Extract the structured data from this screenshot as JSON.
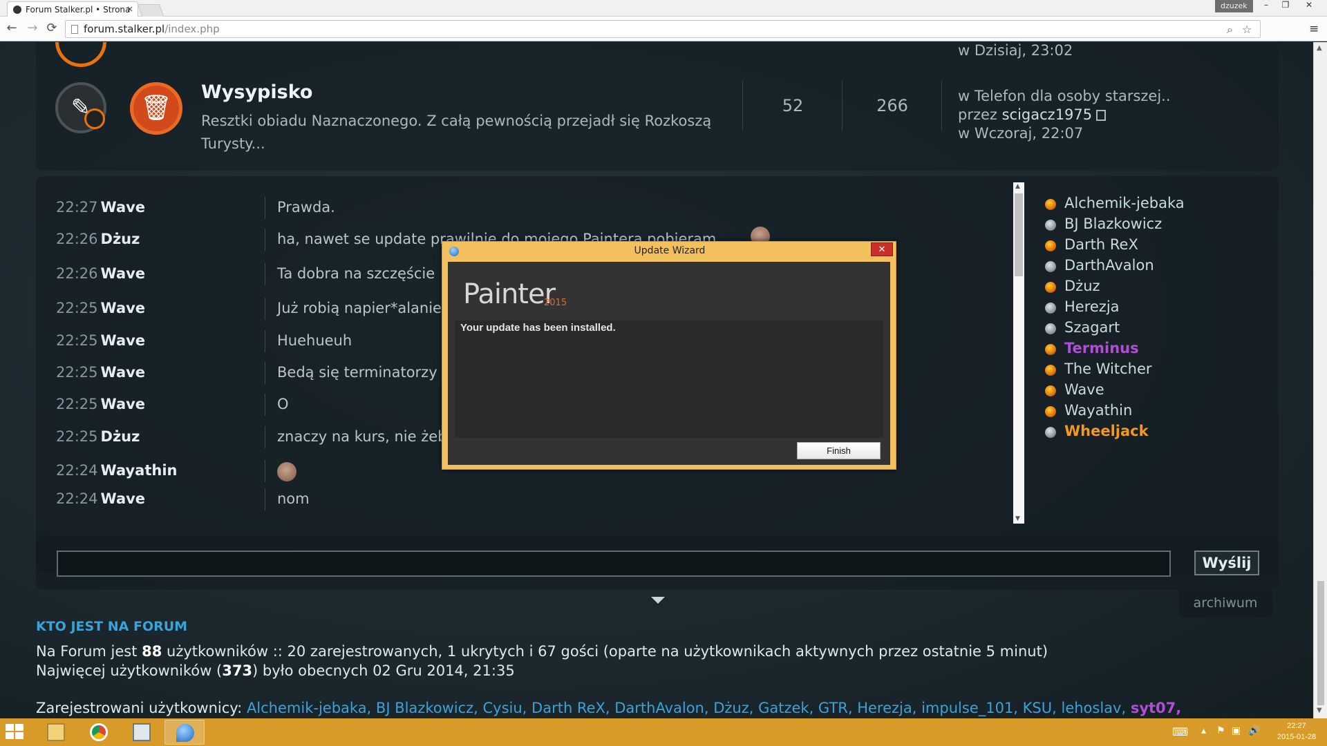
{
  "browser": {
    "tab_title": "Forum Stalker.pl • Strona",
    "tab_close": "×",
    "user_badge": "dzuzek",
    "url_host": "forum.stalker.pl",
    "url_path": "/index.php",
    "back": "←",
    "forward": "→",
    "reload": "⟳",
    "menu": "≡",
    "win_min": "–",
    "win_max": "❐",
    "win_close": "✕"
  },
  "forum": {
    "top_last_time": "w Dzisiaj, 23:02",
    "title": "Wysypisko",
    "description": "Resztki obiadu Naznaczonego. Z całą pewnością przejadł się Rozkoszą Turysty...",
    "topics": "52",
    "posts": "266",
    "last_in": "w Telefon dla osoby starszej..",
    "last_by_prefix": "przez ",
    "last_by": "scigacz1975",
    "last_time": "w Wczoraj, 22:07"
  },
  "chat": {
    "messages": [
      {
        "time": "22:27",
        "nick": "Wave",
        "text": "Prawda."
      },
      {
        "time": "22:26",
        "nick": "Dżuz",
        "text": "ha, nawet se update prawilnie do mojego Paintera pobieram"
      },
      {
        "time": "22:26",
        "nick": "Wave",
        "text": "Ta dobra na szczęście"
      },
      {
        "time": "22:25",
        "nick": "Wave",
        "text": "Już robią napier*alanie"
      },
      {
        "time": "22:25",
        "nick": "Wave",
        "text": "Huehueuh"
      },
      {
        "time": "22:25",
        "nick": "Wave",
        "text": "Bedą się terminatorzy"
      },
      {
        "time": "22:25",
        "nick": "Wave",
        "text": "O"
      },
      {
        "time": "22:25",
        "nick": "Dżuz",
        "text": "znaczy na kurs, nie żeby"
      },
      {
        "time": "22:24",
        "nick": "Wayathin",
        "text": ""
      },
      {
        "time": "22:24",
        "nick": "Wave",
        "text": "nom"
      }
    ],
    "send_label": "Wyślij",
    "archive_label": "archiwum"
  },
  "online_users": [
    {
      "name": "Alchemik-jebaka",
      "status": "on"
    },
    {
      "name": "BJ Blazkowicz",
      "status": "off"
    },
    {
      "name": "Darth ReX",
      "status": "on"
    },
    {
      "name": "DarthAvalon",
      "status": "off"
    },
    {
      "name": "Dżuz",
      "status": "on"
    },
    {
      "name": "Herezja",
      "status": "off"
    },
    {
      "name": "Szagart",
      "status": "off"
    },
    {
      "name": "Terminus",
      "status": "on",
      "color": "#b04fd6",
      "bold": true
    },
    {
      "name": "The Witcher",
      "status": "on"
    },
    {
      "name": "Wave",
      "status": "on"
    },
    {
      "name": "Wayathin",
      "status": "on"
    },
    {
      "name": "Wheeljack",
      "status": "off",
      "color": "#f39a1e",
      "bold": true
    }
  ],
  "who_online": {
    "title": "KTO JEST NA FORUM",
    "line1_pre": "Na Forum jest ",
    "line1_count": "88",
    "line1_post": " użytkowników :: 20 zarejestrowanych, 1 ukrytych i 67 gości (oparte na użytkownikach aktywnych przez ostatnie 5 minut)",
    "line2_pre": "Najwięcej użytkowników (",
    "line2_count": "373",
    "line2_post": ") było obecnych 02 Gru 2014, 21:35",
    "registered_label": "Zarejestrowani użytkownicy: ",
    "registered_list": "Alchemik-jebaka, BJ Blazkowicz, Cysiu, Darth ReX, DarthAvalon, Dżuz, Gatzek, GTR, Herezja, impulse_101, KSU, lehoslav, ",
    "registered_highlight": "syt07,"
  },
  "dialog": {
    "title": "Update Wizard",
    "close": "✕",
    "logo": "Painter",
    "logo_year": "2015",
    "message": "Your update has been installed.",
    "finish_label": "Finish"
  },
  "taskbar": {
    "clock_time": "22:27",
    "clock_date": "2015-01-28"
  },
  "colors": {
    "accent_orange": "#e8720e",
    "link_blue": "#3aa3d9",
    "dialog_frame": "#f2c15d",
    "taskbar": "#d89a28"
  }
}
